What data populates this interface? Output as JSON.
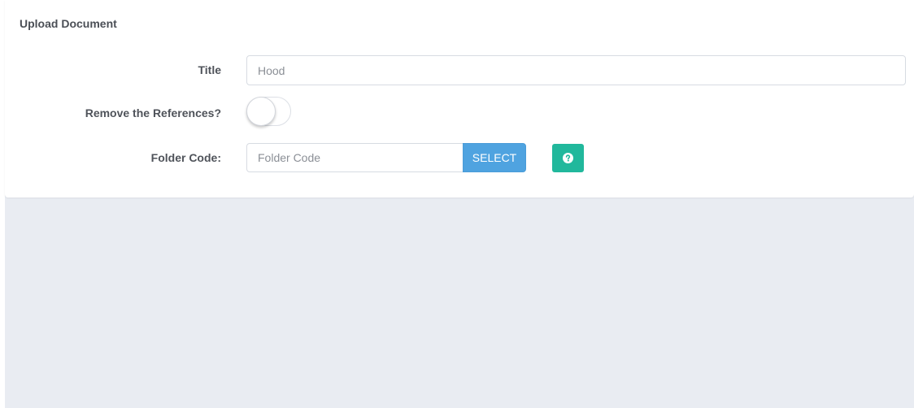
{
  "card": {
    "title": "Upload Document"
  },
  "form": {
    "title_label": "Title",
    "title_value": "Hood",
    "remove_references_label": "Remove the References?",
    "remove_references_on": false,
    "folder_code_label": "Folder Code:",
    "folder_code_placeholder": "Folder Code",
    "select_label": "SELECT",
    "help_icon": "question-circle-icon"
  },
  "colors": {
    "select_button": "#4fa3e0",
    "help_button": "#21b89c",
    "page_background": "#e9ecf2"
  }
}
